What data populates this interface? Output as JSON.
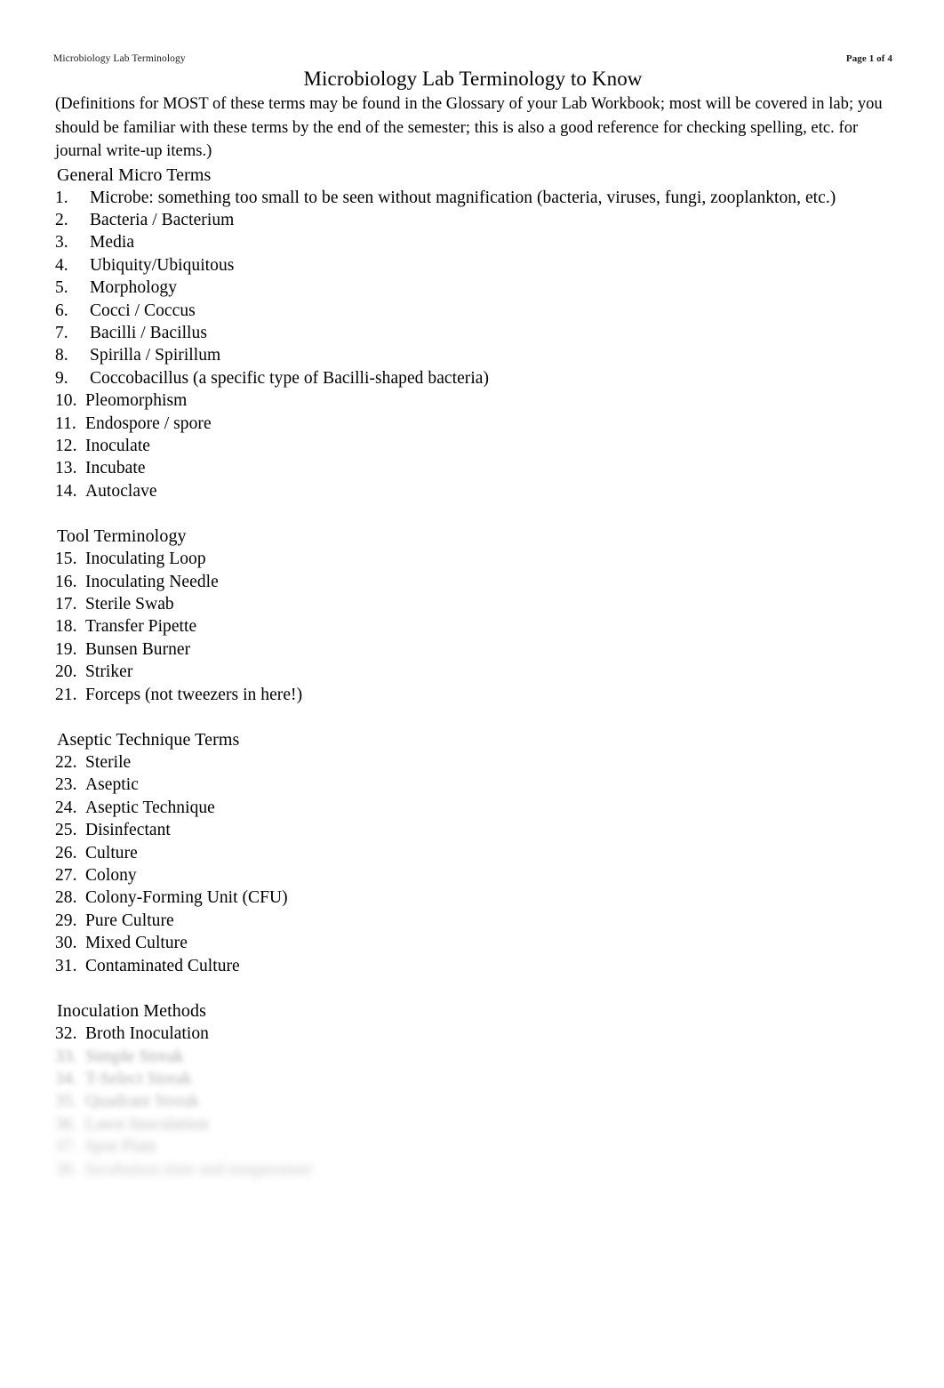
{
  "header": {
    "left": "Microbiology Lab Terminology",
    "right": "Page 1 of 4"
  },
  "title": "Microbiology Lab Terminology to Know",
  "intro": "(Definitions for MOST of these terms may be found in the Glossary of your Lab Workbook; most will be covered in lab; you should be familiar with these terms by the end of the semester; this is also a good reference for checking spelling, etc. for journal write-up items.)",
  "sections": [
    {
      "heading": "General Micro Terms",
      "items": [
        {
          "num": "1.",
          "text": "Microbe: something too small to be seen without magnification (bacteria, viruses, fungi, zooplankton, etc.)"
        },
        {
          "num": "2.",
          "text": "Bacteria / Bacterium"
        },
        {
          "num": "3.",
          "text": "Media"
        },
        {
          "num": "4.",
          "text": "Ubiquity/Ubiquitous"
        },
        {
          "num": "5.",
          "text": "Morphology"
        },
        {
          "num": "6.",
          "text": "Cocci / Coccus"
        },
        {
          "num": "7.",
          "text": "Bacilli / Bacillus"
        },
        {
          "num": "8.",
          "text": "Spirilla / Spirillum"
        },
        {
          "num": "9.",
          "text": "Coccobacillus (a specific type of Bacilli-shaped bacteria)"
        },
        {
          "num": "10.",
          "text": "Pleomorphism"
        },
        {
          "num": "11.",
          "text": "Endospore / spore"
        },
        {
          "num": "12.",
          "text": "Inoculate"
        },
        {
          "num": "13.",
          "text": "Incubate"
        },
        {
          "num": "14.",
          "text": "Autoclave"
        }
      ]
    },
    {
      "heading": "Tool Terminology",
      "items": [
        {
          "num": "15.",
          "text": "Inoculating Loop"
        },
        {
          "num": "16.",
          "text": "Inoculating Needle"
        },
        {
          "num": "17.",
          "text": "Sterile Swab"
        },
        {
          "num": "18.",
          "text": "Transfer Pipette"
        },
        {
          "num": "19.",
          "text": "Bunsen Burner"
        },
        {
          "num": "20.",
          "text": "Striker"
        },
        {
          "num": "21.",
          "text": "Forceps (not tweezers in here!)"
        }
      ]
    },
    {
      "heading": "Aseptic Technique Terms",
      "items": [
        {
          "num": "22.",
          "text": "Sterile"
        },
        {
          "num": "23.",
          "text": "Aseptic"
        },
        {
          "num": "24.",
          "text": "Aseptic Technique"
        },
        {
          "num": "25.",
          "text": "Disinfectant"
        },
        {
          "num": "26.",
          "text": "Culture"
        },
        {
          "num": "27.",
          "text": "Colony"
        },
        {
          "num": "28.",
          "text": "Colony-Forming Unit (CFU)"
        },
        {
          "num": "29.",
          "text": "Pure Culture"
        },
        {
          "num": "30.",
          "text": "Mixed Culture"
        },
        {
          "num": "31.",
          "text": "Contaminated Culture"
        }
      ]
    },
    {
      "heading": "Inoculation Methods",
      "items": [
        {
          "num": "32.",
          "text": "Broth Inoculation"
        },
        {
          "num": "33.",
          "text": "Simple Streak",
          "fade": "f1"
        },
        {
          "num": "34.",
          "text": "T-Select Streak",
          "fade": "f2"
        },
        {
          "num": "35.",
          "text": "Quadrant Streak",
          "fade": "f3"
        },
        {
          "num": "36.",
          "text": "Lawn Inoculation",
          "fade": "f4"
        },
        {
          "num": "37.",
          "text": "Spot Plate",
          "fade": "f5"
        },
        {
          "num": "38.",
          "text": "Incubation time and temperature",
          "fade": "f6"
        }
      ]
    }
  ]
}
